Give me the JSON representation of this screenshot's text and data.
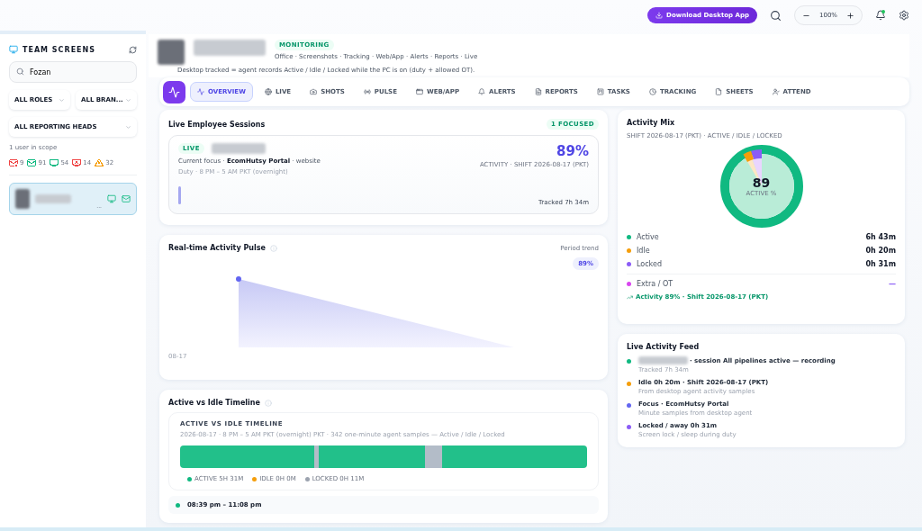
{
  "topbar": {
    "download_button": "Download Desktop App",
    "zoom": "100%",
    "notification_dot": true
  },
  "sidebar": {
    "title": "TEAM SCREENS",
    "search": {
      "value": "Fozan"
    },
    "filters": [
      {
        "label": "ALL ROLES"
      },
      {
        "label": "ALL BRAN..."
      },
      {
        "label": "ALL REPORTING HEADS"
      }
    ],
    "scope": "1 user in scope",
    "stats": [
      {
        "kind": "mail-x",
        "count": "9",
        "color": "#ef4444"
      },
      {
        "kind": "mail",
        "count": "91",
        "color": "#10b981"
      },
      {
        "kind": "monitor",
        "count": "54",
        "color": "#10b981"
      },
      {
        "kind": "monitor-x",
        "count": "14",
        "color": "#ef4444"
      },
      {
        "kind": "alert",
        "count": "32",
        "color": "#f59e0b"
      }
    ],
    "users": [
      {
        "selected": true,
        "suffix": "..."
      }
    ]
  },
  "header": {
    "badge": "MONITORING",
    "modules": "Office · Screenshots · Tracking · Web/App · Alerts · Reports · Live",
    "note": "Desktop tracked = agent records Active / Idle / Locked while the PC is on (duty + allowed OT)."
  },
  "tabs": [
    {
      "label": "OVERVIEW",
      "kind": "activity",
      "selected": true
    },
    {
      "label": "LIVE",
      "kind": "globe",
      "selected": false
    },
    {
      "label": "SHOTS",
      "kind": "camera",
      "selected": false
    },
    {
      "label": "PULSE",
      "kind": "radio",
      "selected": false
    },
    {
      "label": "WEB/APP",
      "kind": "window",
      "selected": false
    },
    {
      "label": "ALERTS",
      "kind": "bell",
      "selected": false
    },
    {
      "label": "REPORTS",
      "kind": "report",
      "selected": false
    },
    {
      "label": "TASKS",
      "kind": "kanban",
      "selected": false
    },
    {
      "label": "TRACKING",
      "kind": "clock",
      "selected": false
    },
    {
      "label": "SHEETS",
      "kind": "file",
      "selected": false
    },
    {
      "label": "ATTEND",
      "kind": "user",
      "selected": false
    }
  ],
  "sessions": {
    "title": "Live Employee Sessions",
    "badge": "1 FOCUSED",
    "card": {
      "live": "LIVE",
      "focus": "Current focus · **EcomHutsy Portal** · website",
      "duty": "Duty · 8 PM – 5 AM PKT (overnight)",
      "percent": "89%",
      "activity": "ACTIVITY · SHIFT 2026-08-17 (PKT)",
      "tracked": "Tracked 7h 34m"
    }
  },
  "pulse": {
    "title": "Real-time Activity Pulse",
    "trend": "Period trend",
    "value": "89%",
    "date": "08-17"
  },
  "timeline": {
    "title": "Active vs Idle Timeline",
    "heading": "ACTIVE VS IDLE TIMELINE",
    "subtitle": "2026-08-17 · 8 PM – 5 AM PKT (overnight) PKT · 342 one-minute agent samples — Active / Idle / Locked",
    "legend": [
      {
        "label": "ACTIVE 5H 31M",
        "color": "#10b981"
      },
      {
        "label": "IDLE 0H 0M",
        "color": "#f59e0b"
      },
      {
        "label": "LOCKED 0H 11M",
        "color": "#9ca3af"
      }
    ],
    "segment": "08:39 pm – 11:08 pm"
  },
  "mix": {
    "title": "Activity Mix",
    "subtitle": "SHIFT 2026-08-17 (PKT) · ACTIVE / IDLE / LOCKED",
    "center": "89",
    "center_label": "ACTIVE %",
    "items": [
      {
        "label": "Active",
        "value": "6h 43m",
        "color": "#10b981"
      },
      {
        "label": "Idle",
        "value": "0h 20m",
        "color": "#f59e0b"
      },
      {
        "label": "Locked",
        "value": "0h 31m",
        "color": "#8b5cf6"
      },
      {
        "label": "Extra / OT",
        "value": "—",
        "color": "#d946ef"
      }
    ],
    "footer": "Activity 89% · Shift 2026-08-17 (PKT)"
  },
  "feed": {
    "title": "Live Activity Feed",
    "items": [
      {
        "title": "· session All pipelines active — recording",
        "sub": "Tracked 7h 34m",
        "color": "#10b981",
        "redacted": true
      },
      {
        "title": "Idle 0h 20m · Shift 2026-08-17 (PKT)",
        "sub": "From desktop agent activity samples",
        "color": "#f59e0b",
        "redacted": false
      },
      {
        "title": "Focus · EcomHutsy Portal",
        "sub": "Minute samples from desktop agent",
        "color": "#6366f1",
        "redacted": false
      },
      {
        "title": "Locked / away 0h 31m",
        "sub": "Screen lock / sleep during duty",
        "color": "#8b5cf6",
        "redacted": false
      }
    ]
  }
}
